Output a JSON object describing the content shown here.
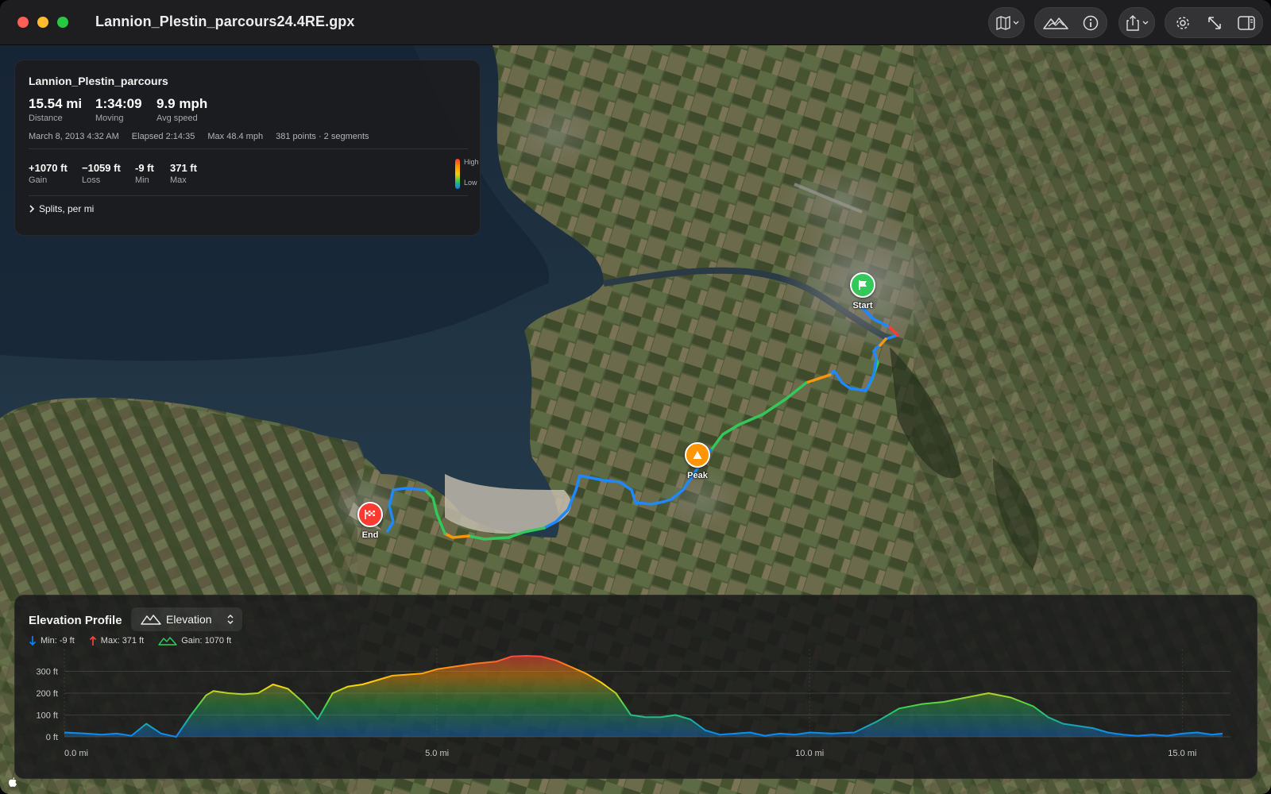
{
  "window": {
    "title": "Lannion_Plestin_parcours24.4RE.gpx"
  },
  "colors": {
    "accent": "#0a84ff",
    "start_pin": "#34c759",
    "peak_pin": "#ff9500",
    "end_pin": "#ff3b30"
  },
  "toolbar": {
    "icons": [
      "map-icon",
      "chevron-down-icon",
      "mountain-icon",
      "info-icon",
      "share-icon",
      "chevron-down-icon",
      "gear-icon",
      "expand-icon",
      "sidebar-icon"
    ]
  },
  "track": {
    "name": "Lannion_Plestin_parcours",
    "stats": [
      {
        "value": "15.54 mi",
        "label": "Distance"
      },
      {
        "value": "1:34:09",
        "label": "Moving"
      },
      {
        "value": "9.9 mph",
        "label": "Avg speed"
      }
    ],
    "meta": [
      "March 8, 2013 4:32 AM",
      "Elapsed 2:14:35",
      "Max 48.4 mph",
      "381 points · 2 segments"
    ],
    "elevation_stats": [
      {
        "value": "+1070 ft",
        "label": "Gain"
      },
      {
        "value": "−1059 ft",
        "label": "Loss"
      },
      {
        "value": "-9 ft",
        "label": "Min"
      },
      {
        "value": "371 ft",
        "label": "Max"
      }
    ],
    "gradient_high": "High",
    "gradient_low": "Low",
    "splits_label": "Splits, per mi"
  },
  "pins": {
    "start": "Start",
    "peak": "Peak",
    "end": "End"
  },
  "elevation": {
    "title": "Elevation Profile",
    "mode": "Elevation",
    "legend": [
      {
        "icon": "arrow-down-icon",
        "text": "Min: -9 ft"
      },
      {
        "icon": "arrow-up-icon",
        "text": "Max: 371 ft"
      },
      {
        "icon": "mountain-icon",
        "text": "Gain: 1070 ft"
      }
    ]
  },
  "chart_data": {
    "type": "area",
    "xlabel": "",
    "ylabel": "",
    "x_unit": "mi",
    "y_unit": "ft",
    "xlim": [
      0,
      15.54
    ],
    "ylim": [
      0,
      371
    ],
    "x_ticks": [
      "0.0 mi",
      "5.0 mi",
      "10.0 mi",
      "15.0 mi"
    ],
    "x_tick_values": [
      0,
      5,
      10,
      15
    ],
    "y_ticks": [
      "0 ft",
      "100 ft",
      "200 ft",
      "300 ft"
    ],
    "y_tick_values": [
      0,
      100,
      200,
      300
    ],
    "x": [
      0,
      0.3,
      0.5,
      0.7,
      0.9,
      1.1,
      1.3,
      1.5,
      1.7,
      1.9,
      2.0,
      2.2,
      2.4,
      2.6,
      2.8,
      3.0,
      3.2,
      3.4,
      3.6,
      3.8,
      4.0,
      4.2,
      4.4,
      4.6,
      4.8,
      5.0,
      5.2,
      5.5,
      5.8,
      6.0,
      6.2,
      6.4,
      6.6,
      6.8,
      7.0,
      7.2,
      7.4,
      7.6,
      7.8,
      8.0,
      8.2,
      8.4,
      8.6,
      8.8,
      9.0,
      9.2,
      9.4,
      9.6,
      9.8,
      10.0,
      10.3,
      10.6,
      10.9,
      11.2,
      11.5,
      11.8,
      12.1,
      12.4,
      12.7,
      13.0,
      13.2,
      13.4,
      13.6,
      13.8,
      14.0,
      14.2,
      14.4,
      14.6,
      14.8,
      15.0,
      15.2,
      15.4,
      15.54
    ],
    "series": [
      {
        "values": [
          20,
          15,
          10,
          15,
          5,
          60,
          15,
          0,
          100,
          190,
          210,
          200,
          195,
          200,
          240,
          220,
          160,
          80,
          200,
          230,
          240,
          260,
          280,
          285,
          290,
          310,
          320,
          335,
          345,
          368,
          371,
          368,
          350,
          320,
          290,
          250,
          200,
          100,
          90,
          90,
          100,
          80,
          30,
          10,
          15,
          20,
          5,
          15,
          10,
          20,
          15,
          20,
          70,
          130,
          150,
          160,
          180,
          200,
          180,
          140,
          90,
          60,
          50,
          40,
          20,
          10,
          5,
          10,
          5,
          15,
          20,
          10,
          15
        ]
      }
    ]
  }
}
